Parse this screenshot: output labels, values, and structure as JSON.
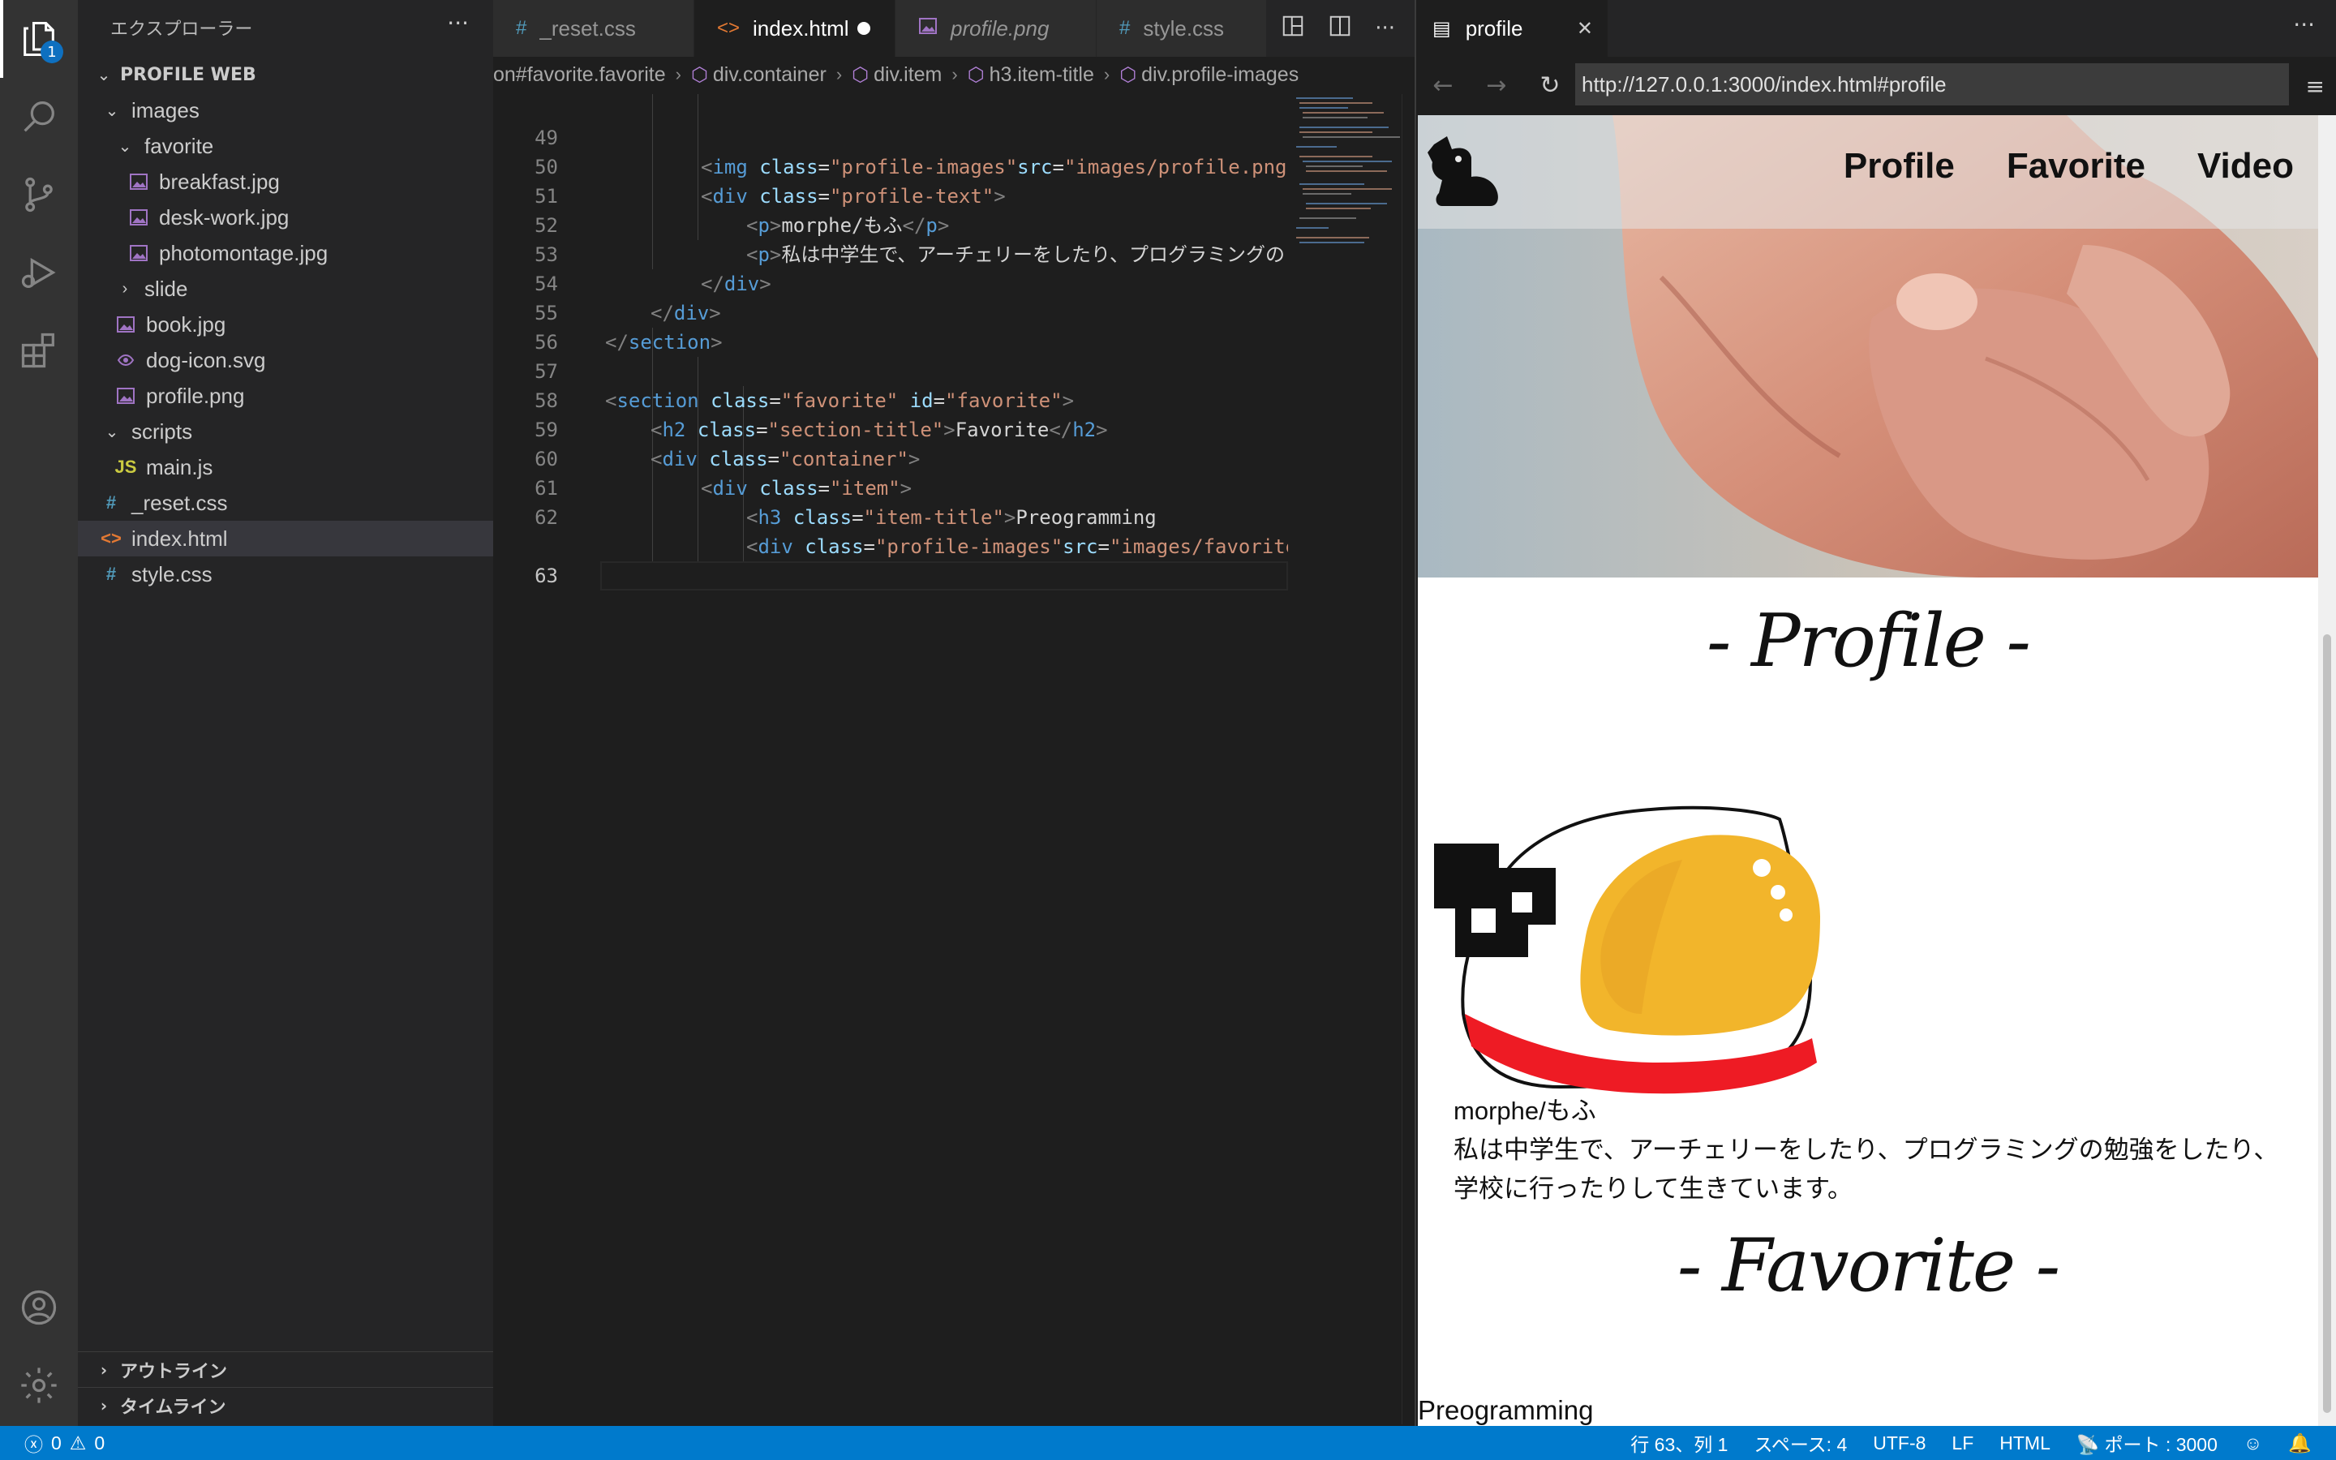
{
  "activity_bar": {
    "explorer_badge": "1",
    "icons": [
      "files-icon",
      "search-icon",
      "source-control-icon",
      "run-debug-icon",
      "extensions-icon",
      "account-icon",
      "settings-gear-icon"
    ]
  },
  "sidebar": {
    "title": "エクスプローラー",
    "more": "···",
    "project": "PROFILE WEB",
    "tree": [
      {
        "label": "images",
        "type": "folder",
        "expanded": true
      },
      {
        "label": "favorite",
        "type": "folder",
        "expanded": true
      },
      {
        "label": "breakfast.jpg",
        "type": "image"
      },
      {
        "label": "desk-work.jpg",
        "type": "image"
      },
      {
        "label": "photomontage.jpg",
        "type": "image"
      },
      {
        "label": "slide",
        "type": "folder",
        "expanded": false
      },
      {
        "label": "book.jpg",
        "type": "image"
      },
      {
        "label": "dog-icon.svg",
        "type": "svg"
      },
      {
        "label": "profile.png",
        "type": "image"
      },
      {
        "label": "scripts",
        "type": "folder",
        "expanded": true
      },
      {
        "label": "main.js",
        "type": "js"
      },
      {
        "label": "_reset.css",
        "type": "css"
      },
      {
        "label": "index.html",
        "type": "html",
        "selected": true
      },
      {
        "label": "style.css",
        "type": "css"
      }
    ],
    "outline": "アウトライン",
    "timeline": "タイムライン"
  },
  "editor": {
    "tabs": [
      {
        "label": "_reset.css",
        "icon": "#"
      },
      {
        "label": "index.html",
        "icon": "<>",
        "active": true,
        "modified": true
      },
      {
        "label": "profile.png",
        "icon": "image"
      },
      {
        "label": "style.css",
        "icon": "#"
      }
    ],
    "breadcrumb": [
      "on#favorite.favorite",
      "div.container",
      "div.item",
      "h3.item-title",
      "div.profile-images"
    ],
    "lines": [
      {
        "n": "49",
        "text": "<img class=\"profile-images\"src=\"images/profile.png\""
      },
      {
        "n": "50",
        "text": "<div class=\"profile-text\">"
      },
      {
        "n": "51",
        "text": "<p>morphe/もふ</p>"
      },
      {
        "n": "52",
        "text": "<p>私は中学生で、アーチェリーをしたり、プログラミングの"
      },
      {
        "n": "53",
        "text": "</div>"
      },
      {
        "n": "54",
        "text": "</div>"
      },
      {
        "n": "55",
        "text": "</section>"
      },
      {
        "n": "56",
        "text": ""
      },
      {
        "n": "57",
        "text": "<section class=\"favorite\" id=\"favorite\">"
      },
      {
        "n": "58",
        "text": "<h2 class=\"section-title\">Favorite</h2>"
      },
      {
        "n": "59",
        "text": "<div class=\"container\">"
      },
      {
        "n": "60",
        "text": "<div class=\"item\">"
      },
      {
        "n": "61",
        "text": "<h3 class=\"item-title\">Preogramming"
      },
      {
        "n": "62",
        "text": "<div class=\"profile-images\"src=\"images/favorite"
      },
      {
        "n": "63",
        "text": ""
      }
    ]
  },
  "preview": {
    "tab_title": "profile",
    "url": "http://127.0.0.1:3000/index.html#profile",
    "nav": [
      "Profile",
      "Favorite",
      "Video"
    ],
    "profile_title": "- Profile -",
    "name": "morphe/もふ",
    "bio_line1": "私は中学生で、アーチェリーをしたり、プログラミングの勉強をしたり、",
    "bio_line2": "学校に行ったりして生きています。",
    "favorite_title": "- Favorite -",
    "item_title": "Preogramming"
  },
  "status_bar": {
    "errors": "0",
    "warnings": "0",
    "position": "行 63、列 1",
    "spaces": "スペース: 4",
    "encoding": "UTF-8",
    "eol": "LF",
    "language": "HTML",
    "port": "ポート : 3000"
  },
  "colors": {
    "accent": "#007acc",
    "html_tag": "#569cd6",
    "attr": "#9cdcfe",
    "string": "#ce9178"
  }
}
